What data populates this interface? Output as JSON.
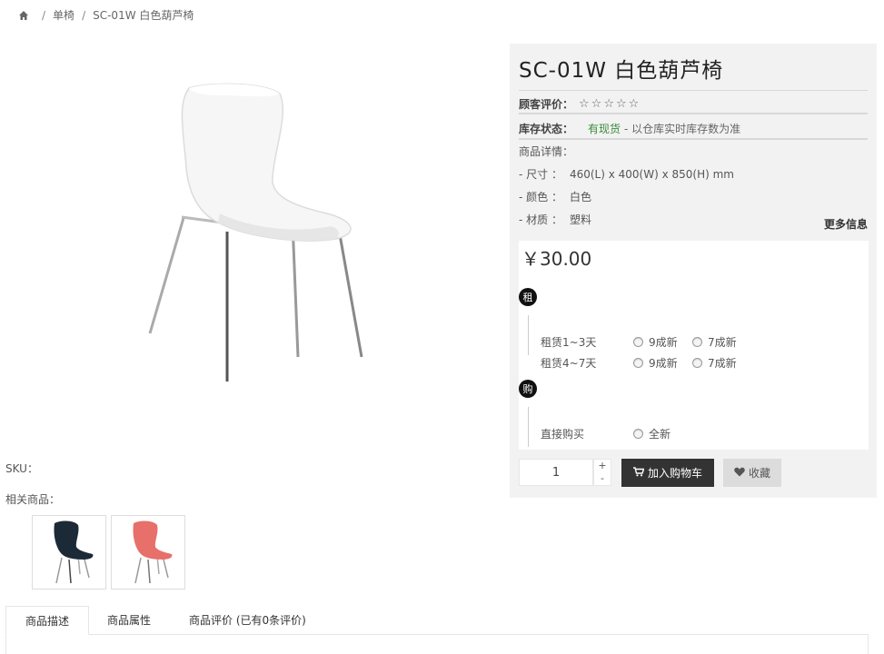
{
  "breadcrumb": {
    "home_icon": "home-icon",
    "items": [
      "单椅",
      "SC-01W 白色葫芦椅"
    ]
  },
  "product": {
    "title": "SC-01W 白色葫芦椅",
    "rating_label": "顾客评价：",
    "rating_value": 0,
    "rating_max": 5,
    "stock_label": "库存状态：",
    "stock_value": "有现货",
    "stock_note": "- 以仓库实时库存数为准",
    "details_label": "商品详情：",
    "details": [
      {
        "key": "- 尺寸 ：",
        "value": "460(L) x 400(W) x 850(H) mm"
      },
      {
        "key": "- 颜色 ：",
        "value": "白色"
      },
      {
        "key": "- 材质 ：",
        "value": "塑料"
      }
    ],
    "more_info": "更多信息",
    "price": "￥30.00"
  },
  "rent": {
    "badge": "租",
    "options": [
      {
        "label": "租赁1~3天",
        "choices": [
          "9成新",
          "7成新"
        ]
      },
      {
        "label": "租赁4~7天",
        "choices": [
          "9成新",
          "7成新"
        ]
      }
    ]
  },
  "buy": {
    "badge": "购",
    "label": "直接购买",
    "choice": "全新"
  },
  "cart": {
    "quantity": "1",
    "plus": "+",
    "minus": "-",
    "add_to_cart": "加入购物车",
    "favorite": "收藏"
  },
  "left": {
    "sku_label": "SKU：",
    "related_label": "相关商品："
  },
  "tabs": [
    "商品描述",
    "商品属性",
    "商品评价 (已有0条评价)"
  ],
  "colors": {
    "panel_bg": "#f2f2f2",
    "stock_green": "#3a8c3a",
    "cart_btn": "#333333",
    "fav_btn": "#dcdcdc"
  }
}
